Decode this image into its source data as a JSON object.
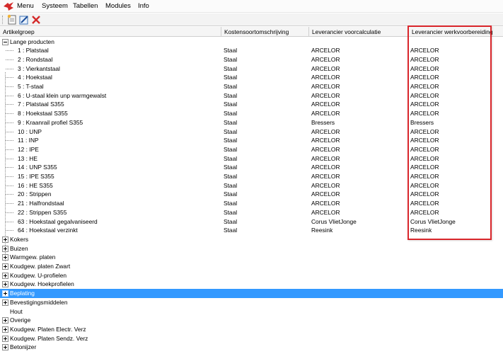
{
  "menubar": {
    "items": [
      "Menu",
      "Systeem",
      "Tabellen",
      "Modules",
      "Info"
    ]
  },
  "toolbar": {
    "buttons": [
      "new-document-icon",
      "edit-icon",
      "delete-icon"
    ]
  },
  "colors": {
    "selection": "#3399ff",
    "highlight_box": "#d9262b",
    "delete_red": "#d42a2a"
  },
  "grid": {
    "columns": [
      "Artikelgroep",
      "Kostensoortomschrijving",
      "Leverancier voorcalculatie",
      "Leverancier werkvoorbereiding"
    ],
    "groups": [
      {
        "label": "Lange producten",
        "expanded": true
      },
      {
        "label": "Kokers",
        "expanded": false
      },
      {
        "label": "Buizen",
        "expanded": false
      },
      {
        "label": "Warmgew. platen",
        "expanded": false
      },
      {
        "label": "Koudgew. platen Zwart",
        "expanded": false
      },
      {
        "label": "Koudgew. U-profielen",
        "expanded": false
      },
      {
        "label": "Koudgew. Hoekprofielen",
        "expanded": false
      },
      {
        "label": "Beplating",
        "expanded": false,
        "selected": true
      },
      {
        "label": "Bevestigingsmiddelen",
        "expanded": false
      },
      {
        "label": "Hout",
        "expanded": false,
        "no_children": true
      },
      {
        "label": "Overige",
        "expanded": false
      },
      {
        "label": "Koudgew. Platen Electr. Verz",
        "expanded": false
      },
      {
        "label": "Koudgew. Platen Sendz. Verz",
        "expanded": false
      },
      {
        "label": "Betonijzer",
        "expanded": false
      }
    ],
    "children": [
      {
        "name": "1 : Platstaal",
        "kosten": "Staal",
        "voorcalc": "ARCELOR",
        "werkvoor": "ARCELOR"
      },
      {
        "name": "2 : Rondstaal",
        "kosten": "Staal",
        "voorcalc": "ARCELOR",
        "werkvoor": "ARCELOR"
      },
      {
        "name": "3 : Vierkantstaal",
        "kosten": "Staal",
        "voorcalc": "ARCELOR",
        "werkvoor": "ARCELOR"
      },
      {
        "name": "4 : Hoekstaal",
        "kosten": "Staal",
        "voorcalc": "ARCELOR",
        "werkvoor": "ARCELOR"
      },
      {
        "name": "5 : T-staal",
        "kosten": "Staal",
        "voorcalc": "ARCELOR",
        "werkvoor": "ARCELOR"
      },
      {
        "name": "6 : U-staal klein unp warmgewalst",
        "kosten": "Staal",
        "voorcalc": "ARCELOR",
        "werkvoor": "ARCELOR"
      },
      {
        "name": "7 : Platstaal S355",
        "kosten": "Staal",
        "voorcalc": "ARCELOR",
        "werkvoor": "ARCELOR"
      },
      {
        "name": "8 : Hoekstaal S355",
        "kosten": "Staal",
        "voorcalc": "ARCELOR",
        "werkvoor": "ARCELOR"
      },
      {
        "name": "9 : Kraanrail profiel S355",
        "kosten": "Staal",
        "voorcalc": "Bressers",
        "werkvoor": "Bressers"
      },
      {
        "name": "10 : UNP",
        "kosten": "Staal",
        "voorcalc": "ARCELOR",
        "werkvoor": "ARCELOR"
      },
      {
        "name": "11 : INP",
        "kosten": "Staal",
        "voorcalc": "ARCELOR",
        "werkvoor": "ARCELOR"
      },
      {
        "name": "12 : IPE",
        "kosten": "Staal",
        "voorcalc": "ARCELOR",
        "werkvoor": "ARCELOR"
      },
      {
        "name": "13 : HE",
        "kosten": "Staal",
        "voorcalc": "ARCELOR",
        "werkvoor": "ARCELOR"
      },
      {
        "name": "14 : UNP S355",
        "kosten": "Staal",
        "voorcalc": "ARCELOR",
        "werkvoor": "ARCELOR"
      },
      {
        "name": "15 : IPE S355",
        "kosten": "Staal",
        "voorcalc": "ARCELOR",
        "werkvoor": "ARCELOR"
      },
      {
        "name": "16 : HE S355",
        "kosten": "Staal",
        "voorcalc": "ARCELOR",
        "werkvoor": "ARCELOR"
      },
      {
        "name": "20 : Strippen",
        "kosten": "Staal",
        "voorcalc": "ARCELOR",
        "werkvoor": "ARCELOR"
      },
      {
        "name": "21 : Halfrondstaal",
        "kosten": "Staal",
        "voorcalc": "ARCELOR",
        "werkvoor": "ARCELOR"
      },
      {
        "name": "22 : Strippen S355",
        "kosten": "Staal",
        "voorcalc": "ARCELOR",
        "werkvoor": "ARCELOR"
      },
      {
        "name": "63 : Hoekstaal gegalvaniseerd",
        "kosten": "Staal",
        "voorcalc": "Corus VlietJonge",
        "werkvoor": "Corus VlietJonge"
      },
      {
        "name": "64 : Hoekstaal verzinkt",
        "kosten": "Staal",
        "voorcalc": "Reesink",
        "werkvoor": "Reesink"
      }
    ]
  }
}
